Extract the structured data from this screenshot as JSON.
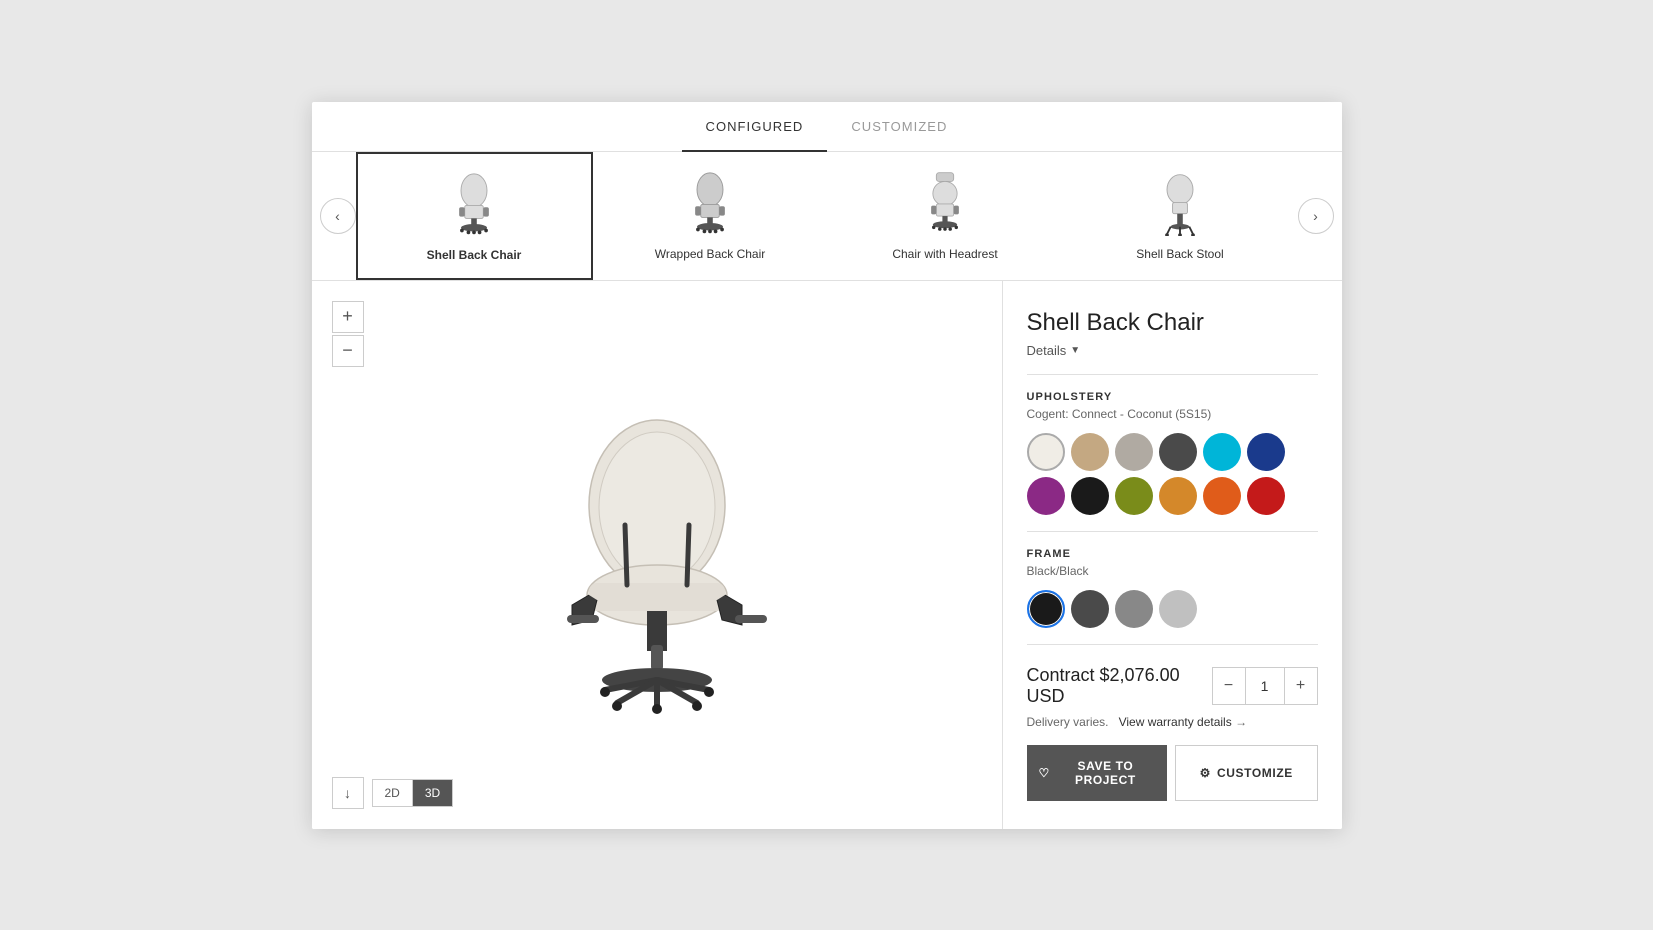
{
  "tabs": [
    {
      "id": "configured",
      "label": "CONFIGURED",
      "active": true
    },
    {
      "id": "customized",
      "label": "CUSTOMIZED",
      "active": false
    }
  ],
  "carousel": {
    "items": [
      {
        "id": "shell-back-chair",
        "label": "Shell Back Chair",
        "selected": true
      },
      {
        "id": "wrapped-back-chair",
        "label": "Wrapped Back Chair",
        "selected": false
      },
      {
        "id": "chair-headrest",
        "label": "Chair with Headrest",
        "selected": false
      },
      {
        "id": "shell-back-stool",
        "label": "Shell Back Stool",
        "selected": false
      }
    ]
  },
  "product": {
    "title": "Shell Back Chair",
    "details_label": "Details",
    "upholstery_label": "UPHOLSTERY",
    "upholstery_value": "Cogent: Connect - Coconut (5S15)",
    "upholstery_colors": [
      {
        "id": "coconut",
        "color": "#f0ede6",
        "selected": true
      },
      {
        "id": "tan",
        "color": "#c4a882",
        "selected": false
      },
      {
        "id": "gray-light",
        "color": "#b0aaa2",
        "selected": false
      },
      {
        "id": "charcoal",
        "color": "#4a4a4a",
        "selected": false
      },
      {
        "id": "cyan",
        "color": "#00b5d8",
        "selected": false
      },
      {
        "id": "blue",
        "color": "#1a3a8c",
        "selected": false
      },
      {
        "id": "purple",
        "color": "#8b2985",
        "selected": false
      },
      {
        "id": "black",
        "color": "#1a1a1a",
        "selected": false
      },
      {
        "id": "olive",
        "color": "#7a8c1a",
        "selected": false
      },
      {
        "id": "orange-light",
        "color": "#d4882a",
        "selected": false
      },
      {
        "id": "orange",
        "color": "#e05c1a",
        "selected": false
      },
      {
        "id": "red",
        "color": "#c41a1a",
        "selected": false
      }
    ],
    "frame_label": "FRAME",
    "frame_value": "Black/Black",
    "frame_colors": [
      {
        "id": "black",
        "color": "#1a1a1a",
        "selected": true
      },
      {
        "id": "dark-gray",
        "color": "#4a4a4a",
        "selected": false
      },
      {
        "id": "gray",
        "color": "#888888",
        "selected": false
      },
      {
        "id": "light-gray",
        "color": "#c0c0c0",
        "selected": false
      }
    ],
    "price": "Contract $2,076.00 USD",
    "quantity": "1",
    "delivery_text": "Delivery varies.",
    "warranty_label": "View warranty details",
    "save_label": "SAVE TO PROJECT",
    "customize_label": "CUSTOMIZE"
  },
  "view_controls": {
    "download_icon": "↓",
    "view_2d": "2D",
    "view_3d": "3D",
    "active_view": "3D"
  },
  "zoom": {
    "plus": "+",
    "minus": "−"
  }
}
